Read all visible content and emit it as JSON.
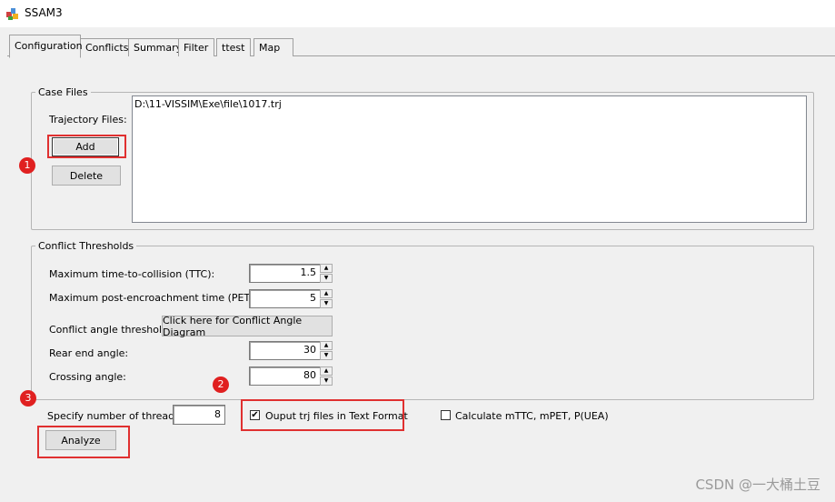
{
  "window": {
    "title": "SSAM3"
  },
  "tabs": [
    {
      "label": "Configuration",
      "active": true
    },
    {
      "label": "Conflicts"
    },
    {
      "label": "Summary"
    },
    {
      "label": "Filter"
    },
    {
      "label": "ttest"
    },
    {
      "label": "Map"
    }
  ],
  "case_files": {
    "group_title": "Case Files",
    "trajectory_label": "Trajectory Files:",
    "add_label": "Add",
    "delete_label": "Delete",
    "files": [
      "D:\\11-VISSIM\\Exe\\file\\1017.trj"
    ]
  },
  "thresholds": {
    "group_title": "Conflict Thresholds",
    "ttc_label": "Maximum time-to-collision (TTC):",
    "ttc_value": "1.5",
    "pet_label": "Maximum post-encroachment time (PET):",
    "pet_value": "5",
    "angle_label": "Conflict angle thresholds:",
    "angle_diagram_button": "Click here for Conflict Angle Diagram",
    "rear_end_label": "Rear end angle:",
    "rear_end_value": "30",
    "crossing_label": "Crossing angle:",
    "crossing_value": "80"
  },
  "options": {
    "threads_label": "Specify number of threads:",
    "threads_value": "8",
    "output_trj_label": "Ouput trj files in Text Format",
    "output_trj_checked": true,
    "calc_label": "Calculate mTTC, mPET, P(UEA)",
    "calc_checked": false,
    "analyze_label": "Analyze"
  },
  "annotations": {
    "badge1": "1",
    "badge2": "2",
    "badge3": "3",
    "color": "#e03030"
  },
  "watermark": "CSDN @一大桶土豆"
}
